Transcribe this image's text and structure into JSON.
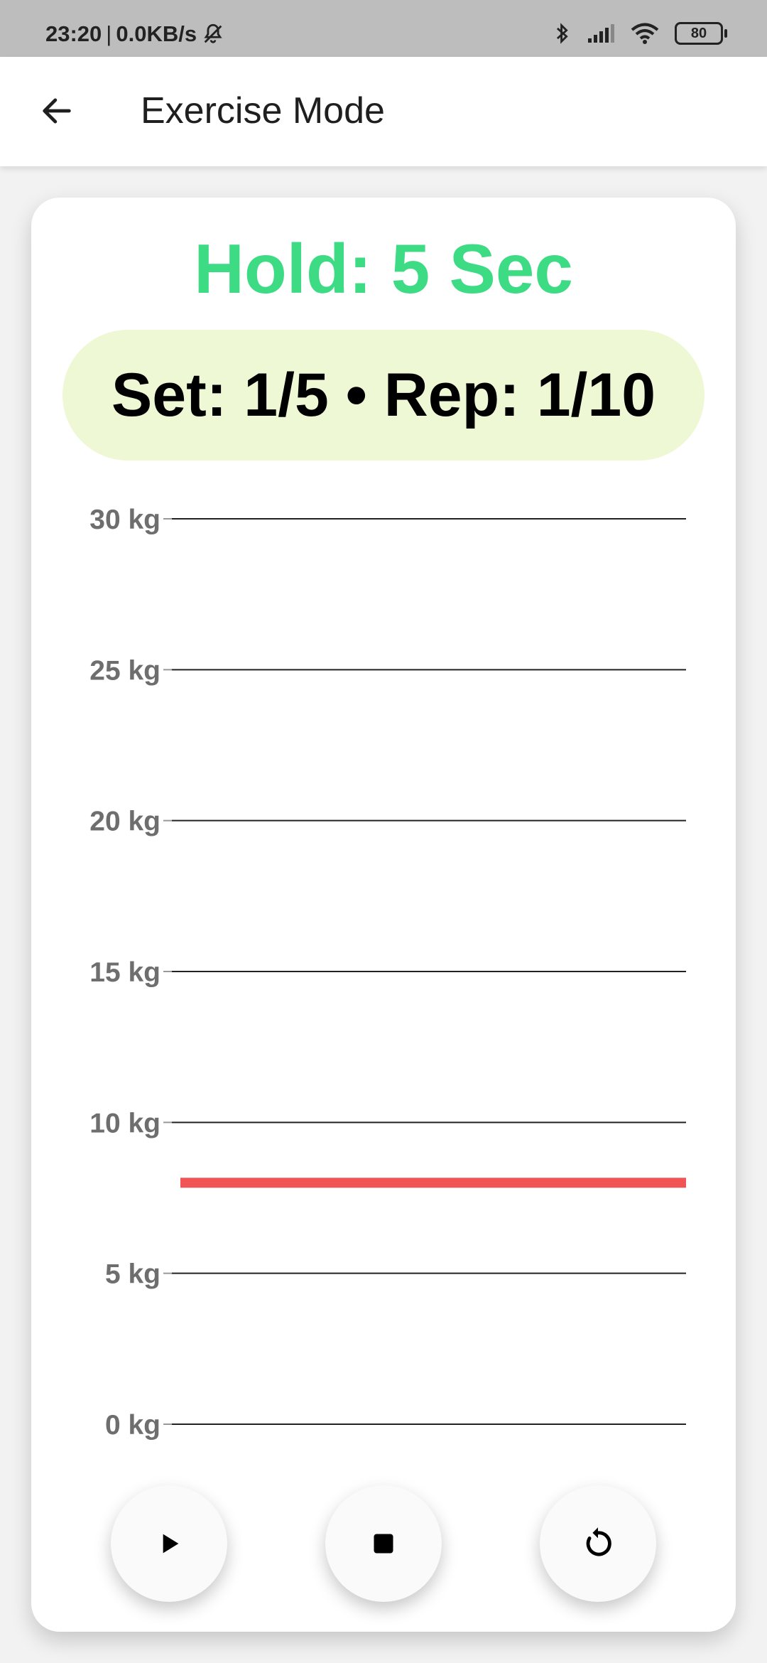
{
  "status_bar": {
    "time": "23:20",
    "network_speed": "0.0KB/s",
    "battery_level": "80",
    "icons": [
      "mute-icon",
      "bluetooth-icon",
      "signal-icon",
      "wifi-icon",
      "battery-icon"
    ]
  },
  "app_bar": {
    "title": "Exercise Mode",
    "back_icon": "arrow-left-icon"
  },
  "exercise": {
    "hold_text": "Hold: 5 Sec",
    "set_rep_text": "Set: 1/5 • Rep: 1/10",
    "hold_color": "#3ddc84",
    "pill_color": "#eff8d4"
  },
  "chart_data": {
    "type": "line",
    "yticks": [
      "30 kg",
      "25 kg",
      "20 kg",
      "15 kg",
      "10 kg",
      "5 kg",
      "0 kg"
    ],
    "ytick_values": [
      30,
      25,
      20,
      15,
      10,
      5,
      0
    ],
    "ylim": [
      0,
      30
    ],
    "series": [
      {
        "values": [
          8,
          8
        ],
        "color": "#f05454"
      }
    ],
    "grid": true,
    "title": "",
    "xlabel": "",
    "ylabel": ""
  },
  "controls": {
    "play_icon": "play-icon",
    "stop_icon": "stop-icon",
    "reset_icon": "reset-icon"
  }
}
